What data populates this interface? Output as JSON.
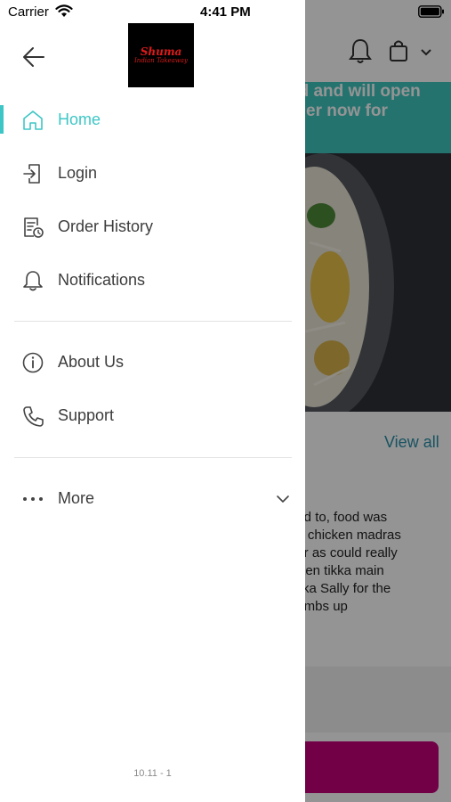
{
  "status_bar": {
    "carrier": "Carrier",
    "time": "4:41 PM"
  },
  "background_app": {
    "banner_line1": "ed and will open",
    "banner_line2": "rder now for",
    "view_all": "View all",
    "review_lines": [
      "had to, food was",
      "he chicken madras",
      "tter as could really",
      "icken tikka main",
      " tikka Sally for the",
      "humbs up"
    ]
  },
  "drawer": {
    "logo": {
      "name": "Shuma",
      "tagline": "Indian Takeaway"
    },
    "nav_primary": [
      {
        "label": "Home",
        "icon": "home-icon",
        "active": true
      },
      {
        "label": "Login",
        "icon": "login-icon",
        "active": false
      },
      {
        "label": "Order History",
        "icon": "order-history-icon",
        "active": false
      },
      {
        "label": "Notifications",
        "icon": "bell-icon",
        "active": false
      }
    ],
    "nav_secondary": [
      {
        "label": "About Us",
        "icon": "info-icon"
      },
      {
        "label": "Support",
        "icon": "phone-icon"
      }
    ],
    "more": {
      "label": "More",
      "icon": "more-dots-icon"
    },
    "version": "10.11 - 1"
  },
  "colors": {
    "accent": "#3ec6c6",
    "banner": "#3fc7bf",
    "cta": "#c4007b",
    "link": "#2a8fa8"
  }
}
